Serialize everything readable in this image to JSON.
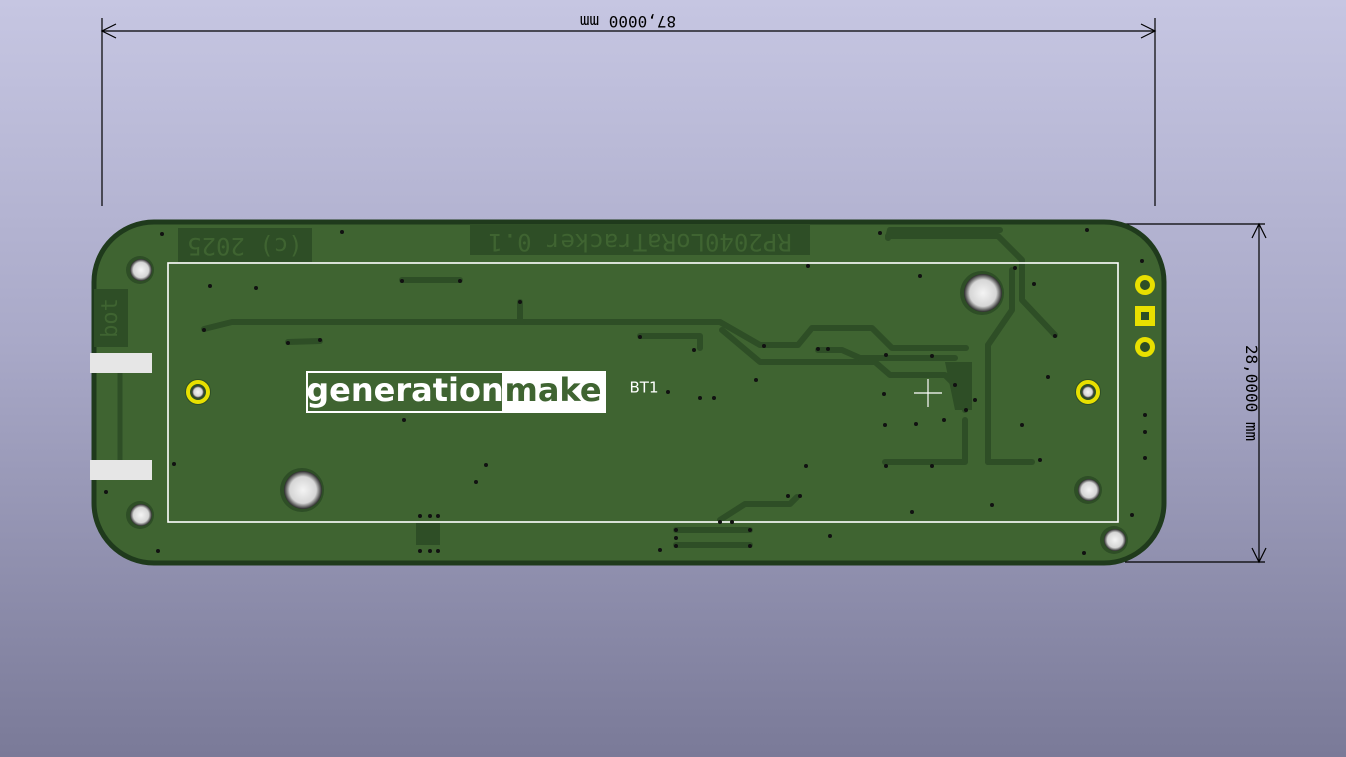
{
  "viewer": {
    "board_name": "RP2040LoRaTracker 0.1",
    "copyright": "(c) 2025",
    "side_label": "bot",
    "component_ref": "BT1",
    "logo": {
      "left": "generation",
      "right": "make"
    },
    "dimensions": {
      "width": "87,0000 mm",
      "height": "28,0000 mm"
    },
    "colors": {
      "background_top": "#c6c6e2",
      "background_bottom": "#7a7a98",
      "board": "#3f6431",
      "board_edge": "#1f3a1c",
      "trace": "#2e4e26",
      "silkscreen": "#ffffff",
      "pad_gold": "#e8e000",
      "dimension_line": "#000000"
    }
  }
}
